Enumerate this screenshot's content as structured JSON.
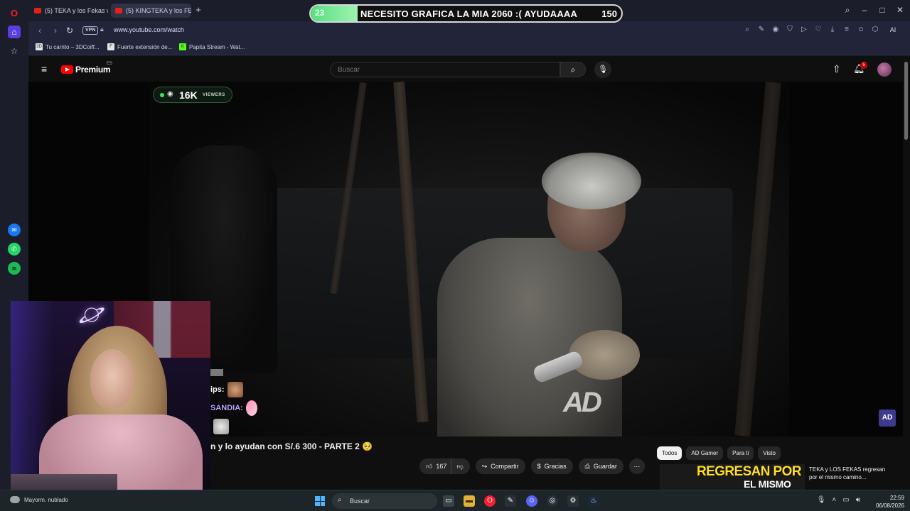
{
  "browser": {
    "tabs": [
      {
        "label": "(5) TEKA y los Fekas van p",
        "active": false
      },
      {
        "label": "(5) KINGTEKA y los FE",
        "active": true
      }
    ],
    "url": "www.youtube.com/watch",
    "vpn_label": "VPN",
    "ai_label": "AI",
    "bookmarks": [
      {
        "label": "Tu carrito – 3DCoiff...",
        "icon": "3D"
      },
      {
        "label": "Fuerte extensión de...",
        "icon": "F"
      },
      {
        "label": "Papita Stream - Wat...",
        "icon": "K"
      }
    ]
  },
  "alert": {
    "count": "23",
    "text": "NECESITO GRAFICA LA MIA 2060 :( AYUDAAAA",
    "goal": "150",
    "progress_percent": 15
  },
  "youtube": {
    "logo_text": "Premium",
    "country": "ES",
    "search_placeholder": "Buscar",
    "notifications_count": "5",
    "video": {
      "title": "n y lo ayudan con S/.6 300 - PARTE 2 🥺",
      "watermark": "AD",
      "channel_badge": "AD",
      "likes": "167",
      "share_label": "Compartir",
      "thanks_label": "Gracias",
      "save_label": "Guardar"
    },
    "chips": [
      "Todos",
      "AD Gamer",
      "Para ti",
      "Visto"
    ],
    "recommended": {
      "thumb_line1": "REGRESAN POR",
      "thumb_line2": "EL MISMO",
      "title": "TEKA y LOS FEKAS regresan por el mismo camino..."
    }
  },
  "stream_overlay": {
    "viewers_count": "16K",
    "viewers_label": "VIEWERS",
    "chat": [
      {
        "user": "ips:",
        "has_emote": true
      },
      {
        "user": "SANDIA:",
        "has_emote": true
      },
      {
        "user": "",
        "has_emote": true
      }
    ]
  },
  "taskbar": {
    "weather": "Mayorm. nublado",
    "search_label": "Buscar",
    "time": "22:59",
    "date": "06/08/2026"
  },
  "colors": {
    "youtube_red": "#ff0000",
    "alert_green": "#55e07f",
    "accent_purple": "#5a3ee0"
  }
}
